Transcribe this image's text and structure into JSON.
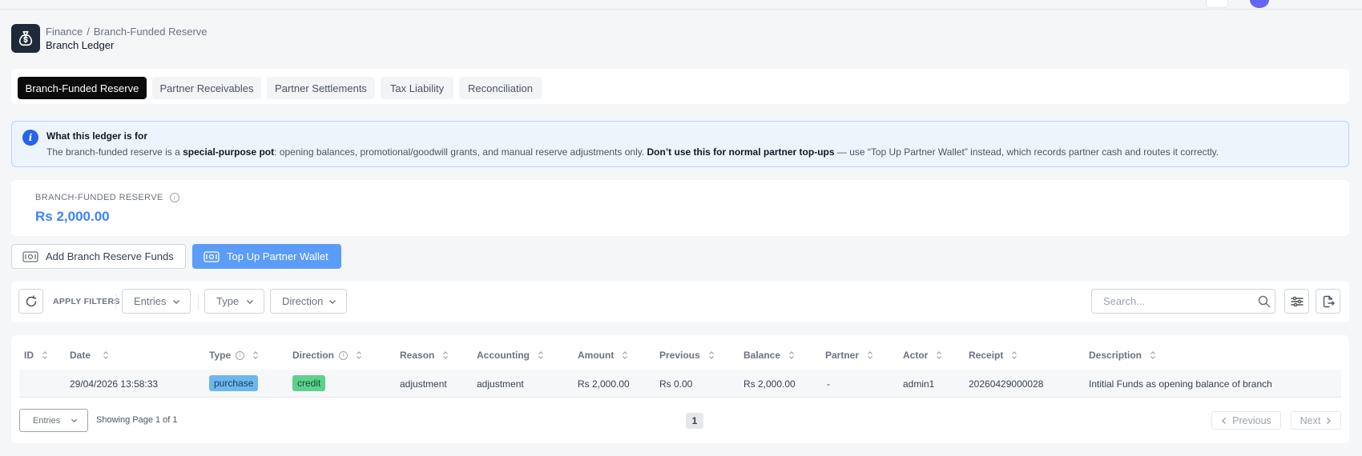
{
  "header": {
    "crumb_parent": "Finance",
    "crumb_separator": "/",
    "crumb_current": "Branch-Funded Reserve",
    "title": "Branch Ledger",
    "logo_icon": "money-bag-icon"
  },
  "tabs": [
    {
      "label": "Branch-Funded Reserve",
      "active": true
    },
    {
      "label": "Partner Receivables",
      "active": false
    },
    {
      "label": "Partner Settlements",
      "active": false
    },
    {
      "label": "Tax Liability",
      "active": false
    },
    {
      "label": "Reconciliation",
      "active": false
    }
  ],
  "info": {
    "title": "What this ledger is for",
    "body_1": "The branch-funded reserve is a ",
    "body_bold_1": "special-purpose pot",
    "body_2": ": opening balances, promotional/goodwill grants, and manual reserve adjustments only. ",
    "body_bold_2": "Don’t use this for normal partner top-ups",
    "body_3": " — use “Top Up Partner Wallet” instead, which records partner cash and routes it correctly."
  },
  "reserve": {
    "label": "BRANCH-FUNDED RESERVE",
    "value": "Rs 2,000.00"
  },
  "actions": {
    "add_label": "Add Branch Reserve Funds",
    "topup_label": "Top Up Partner Wallet"
  },
  "filters": {
    "apply_label": "APPLY FILTERS",
    "entries": "Entries",
    "type": "Type",
    "direction": "Direction",
    "search_placeholder": "Search..."
  },
  "table": {
    "columns": [
      "ID",
      "Date",
      "Type",
      "Direction",
      "Reason",
      "Accounting",
      "Amount",
      "Previous",
      "Balance",
      "Partner",
      "Actor",
      "Receipt",
      "Description"
    ],
    "rows": [
      {
        "id": "",
        "date": "29/04/2026 13:58:33",
        "type": "purchase",
        "direction": "credit",
        "reason": "adjustment",
        "accounting": "adjustment",
        "amount": "Rs 2,000.00",
        "previous": "Rs 0.00",
        "balance": "Rs 2,000.00",
        "partner": "-",
        "actor": "admin1",
        "receipt": "20260429000028",
        "description": "Intitial Funds as opening balance of branch"
      }
    ]
  },
  "pagination": {
    "entries": "Entries",
    "showing": "Showing Page 1 of 1",
    "current_page": "1",
    "previous": "Previous",
    "next": "Next"
  },
  "colors": {
    "accent": "#5b9cf8",
    "reserve_value": "#3b82f6",
    "active_tab": "#0b0b0b",
    "purchase_badge": "#6cb8ee",
    "credit_badge": "#5fd08e"
  }
}
